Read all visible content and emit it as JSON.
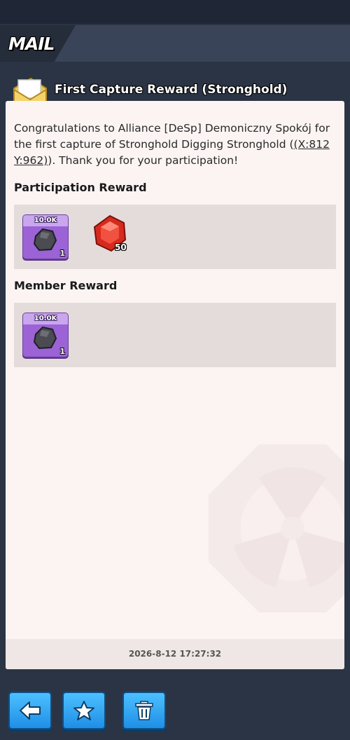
{
  "header": {
    "title": "MAIL"
  },
  "mail": {
    "subject": "First Capture Reward (Stronghold)",
    "message_before": "Congratulations to Alliance [DeSp] Demoniczny Spokój for the first capture of Stronghold Digging Stronghold (",
    "coordinates": "(X:812 Y:962)",
    "message_after": "). Thank you for your participation!",
    "participation_title": "Participation Reward",
    "participation_items": [
      {
        "icon": "stone-icon",
        "top_label": "10.0K",
        "count": "1"
      },
      {
        "icon": "gem-icon",
        "count": "50"
      }
    ],
    "member_title": "Member Reward",
    "member_items": [
      {
        "icon": "stone-icon",
        "top_label": "10.0K",
        "count": "1"
      }
    ],
    "timestamp": "2026-8-12 17:27:32"
  },
  "toolbar": {
    "buttons": [
      {
        "icon": "back-arrow-icon"
      },
      {
        "icon": "star-icon"
      },
      {
        "icon": "trash-icon"
      }
    ]
  },
  "colors": {
    "background": "#2b3445",
    "panel": "#fbf4f3",
    "reward_box": "#e4dcda",
    "item_card": "#9b63d6",
    "button": "#2aa6f5"
  }
}
